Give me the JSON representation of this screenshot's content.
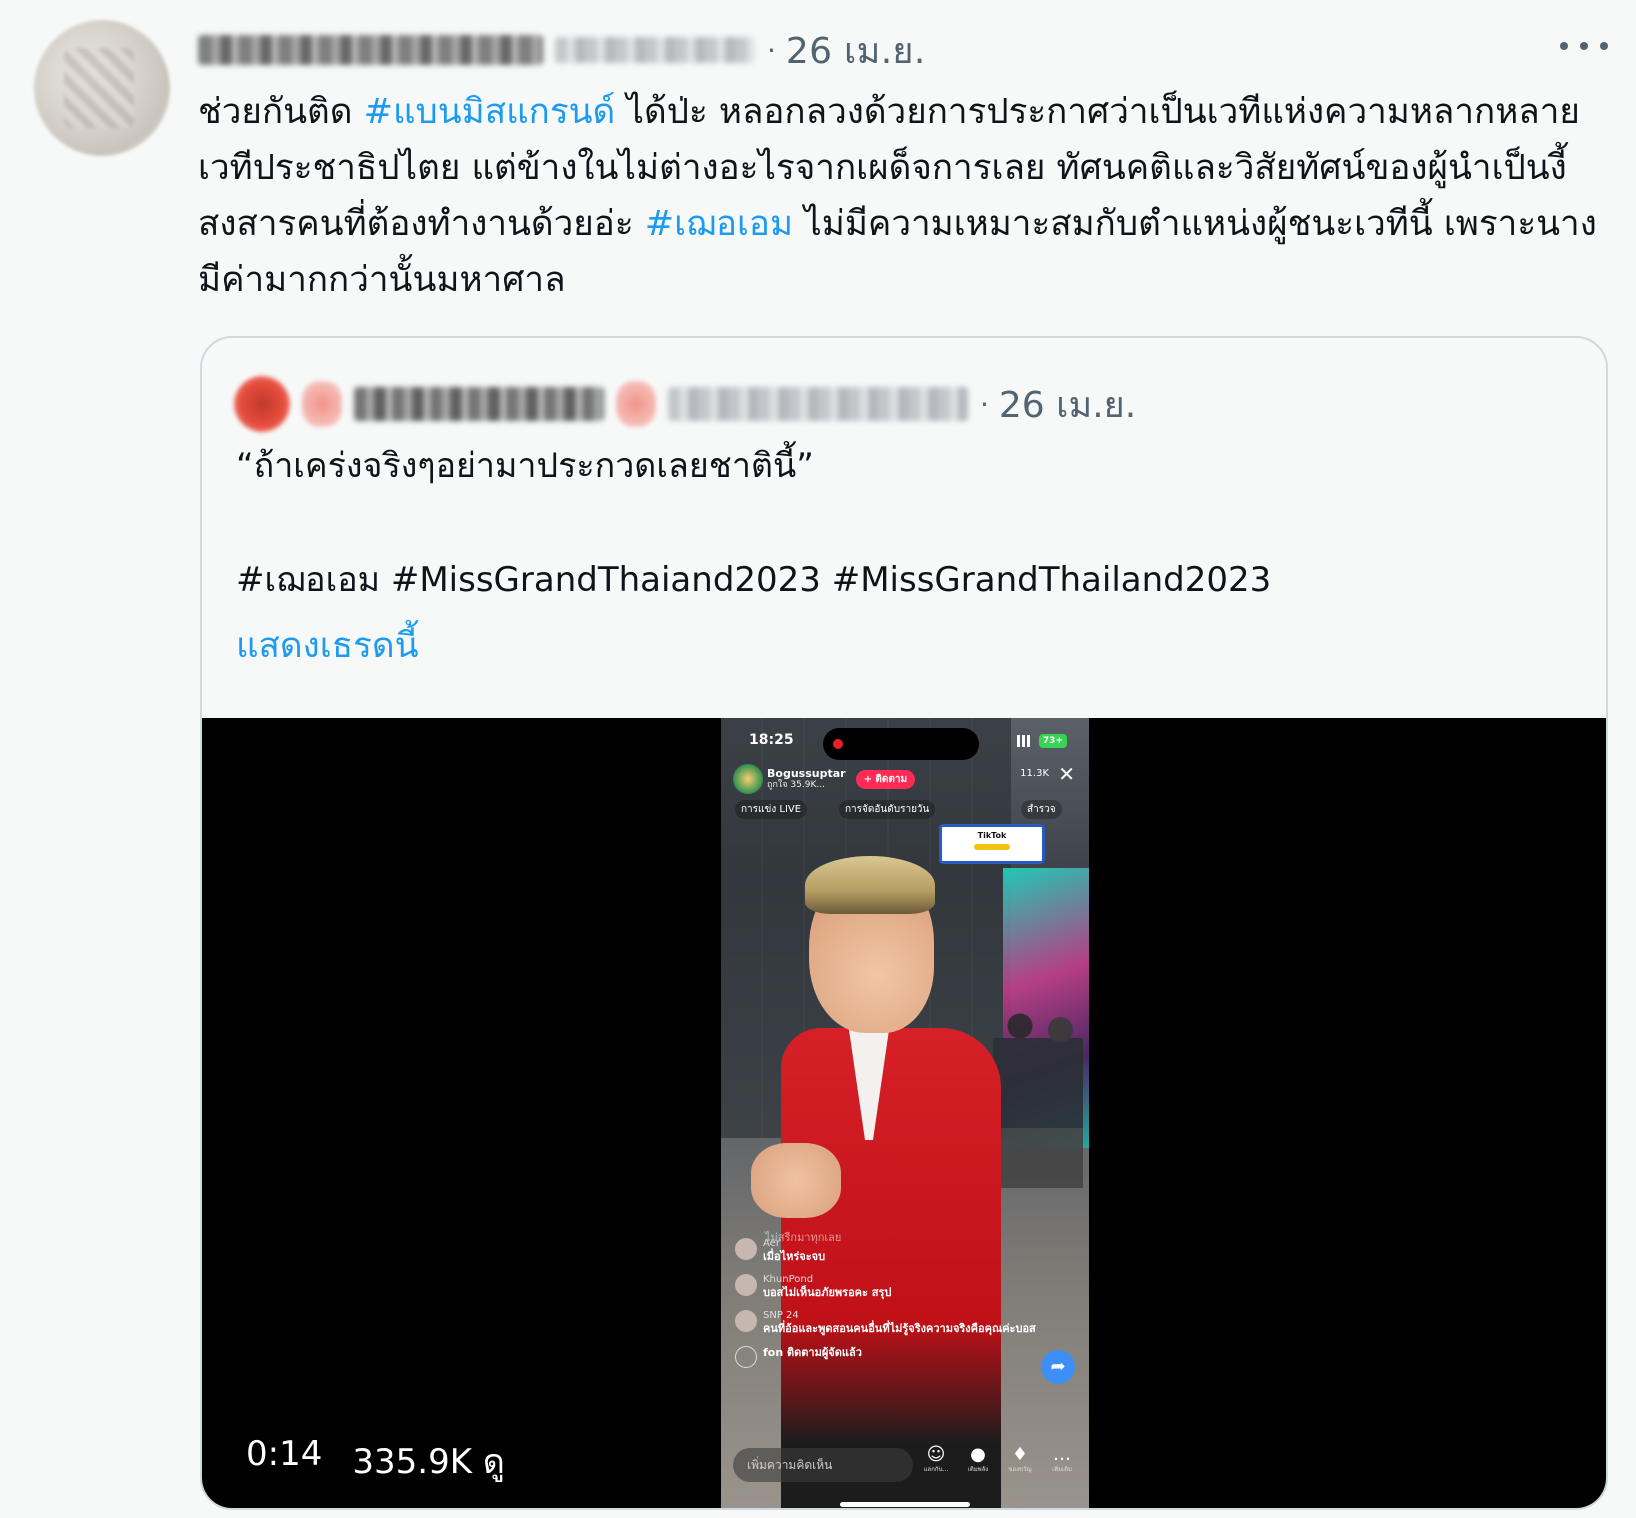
{
  "tweet": {
    "date": "26 เม.ย.",
    "dot": "·",
    "text_parts": {
      "p1": "ช่วยกันติด ",
      "hashtag1": "#แบนมิสแกรนด์",
      "p2": " ได้ป่ะ หลอกลวงด้วยการประกาศว่าเป็นเวทีแห่งความหลากหลาย เวทีประชาธิปไตย แต่ข้างในไม่ต่างอะไรจากเผด็จการเลย ทัศนคติและวิสัยทัศน์ของผู้นำเป็นงี้ สงสารคนที่ต้องทำงานด้วยอ่ะ ",
      "hashtag2": "#เฌอเอม",
      "p3": " ไม่มีความเหมาะสมกับตำแหน่งผู้ชนะเวทีนี้ เพราะนางมีค่ามากกว่านั้นมหาศาล"
    },
    "more_icon": "more-horizontal-icon"
  },
  "quote": {
    "date": "26 เม.ย.",
    "dot": "·",
    "text": "“ถ้าเคร่งจริงๆอย่ามาประกวดเลยชาตินี้”",
    "hashtags": "#เฌอเอม #MissGrandThaiand2023 #MissGrandThailand2023",
    "show_thread": "แสดงเธรดนี้",
    "video": {
      "duration": "0:14",
      "views": "335.9K ดู",
      "phone": {
        "time": "18:25",
        "battery": "73+",
        "host_name": "Bogussuptar",
        "host_likes": "ถูกใจ 35.9K...",
        "follow_label": "+ ติดตาม",
        "viewers": "11.3K",
        "close": "✕",
        "chip1": "การแข่ง LIVE",
        "chip2": "การจัดอันดับรายวัน",
        "chip3": "สำรวจ",
        "banner": "TikTok",
        "faint_comment": "ไม่สรีกมาทุกเลย",
        "comments": [
          {
            "user": "Aer",
            "text": "เมื่อไหร่จะจบ"
          },
          {
            "user": "KhunPond",
            "text": "บอสไม่เห็นอภัยพรอคะ สรุป"
          },
          {
            "user": "SNP 24",
            "text": "คนที่อ้อและพูดสอนคนอื่นที่ไม่รู้จริงความจริงคือคุณค่ะบอส"
          },
          {
            "user": "",
            "text": "fon ติดตามผู้จัดแล้ว"
          }
        ],
        "input_placeholder": "เพิ่มความคิดเห็น",
        "tools": [
          "แลกกัน...",
          "เติมพลัง",
          "ของขวัญ",
          "เพิ่มเติม"
        ]
      }
    }
  }
}
